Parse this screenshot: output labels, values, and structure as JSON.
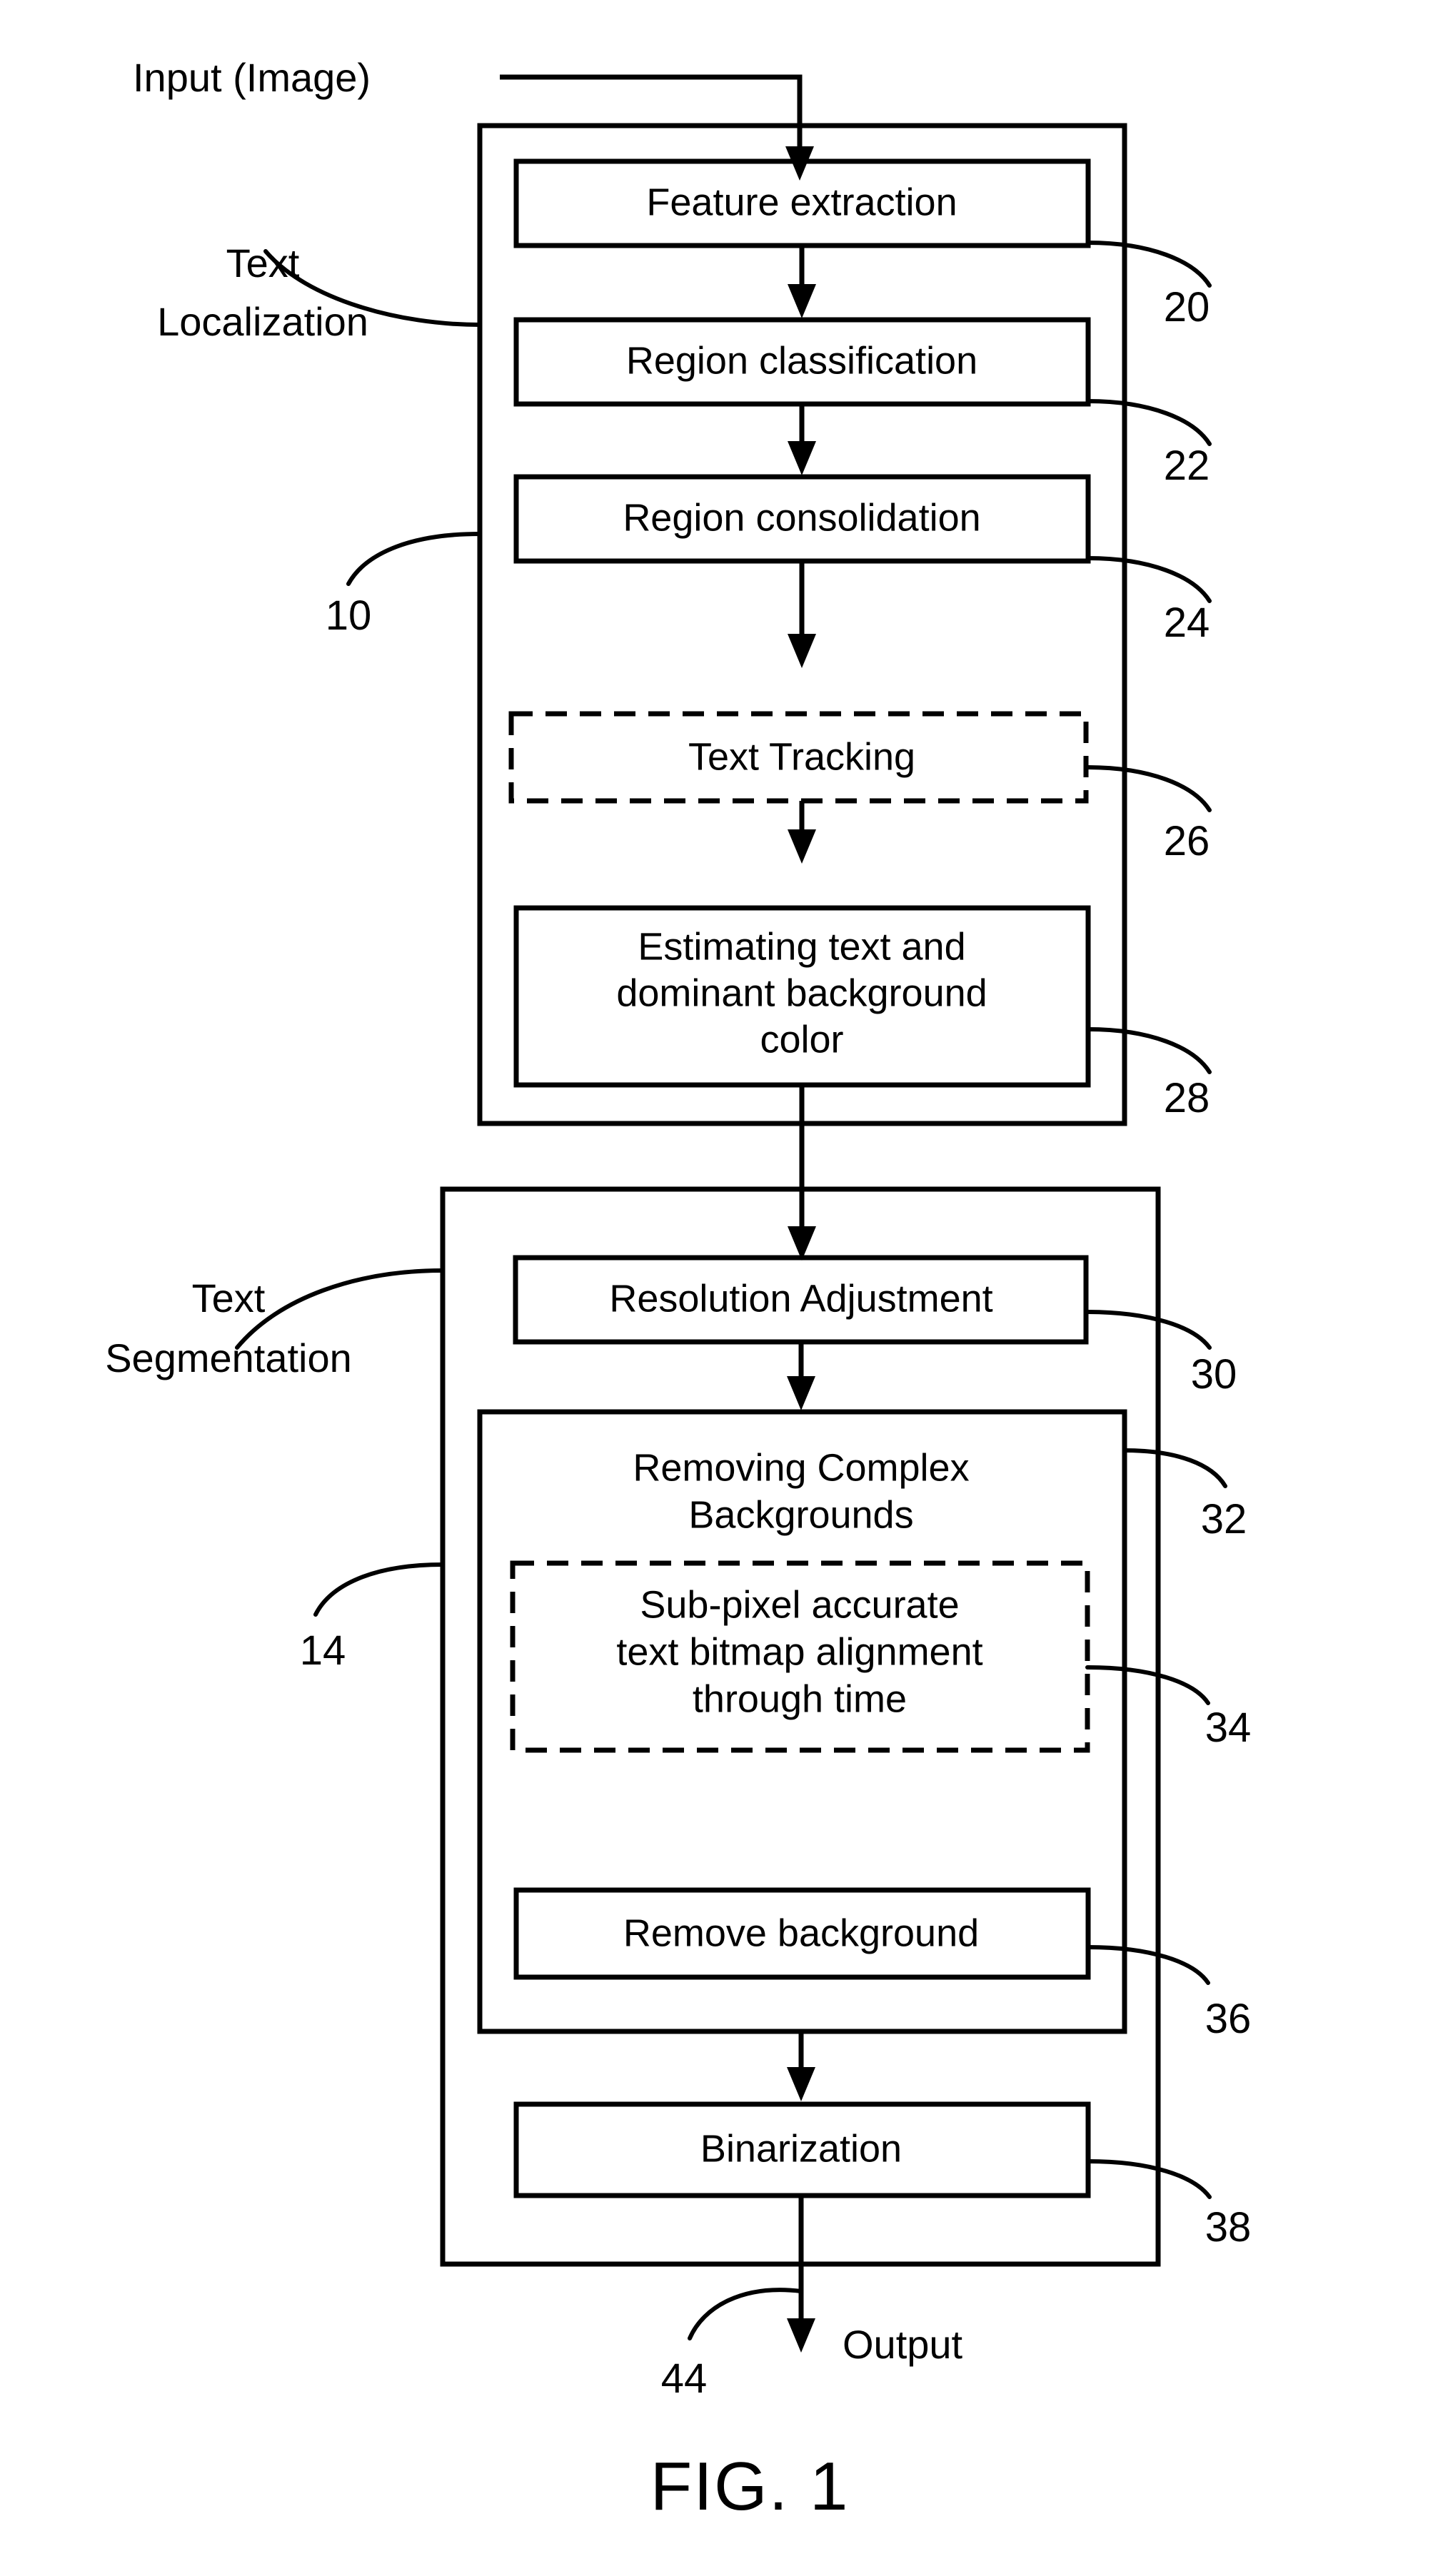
{
  "figure": {
    "caption": "FIG. 1",
    "input_label": "Input (Image)",
    "output_label": "Output",
    "output_ref": "44"
  },
  "stages": [
    {
      "key": "text_localization",
      "side_label_line1": "Text",
      "side_label_line2": "Localization",
      "ref": "10",
      "steps": [
        {
          "key": "feature_extraction",
          "label": "Feature extraction",
          "ref": "20",
          "style": "solid"
        },
        {
          "key": "region_classification",
          "label": "Region classification",
          "ref": "22",
          "style": "solid"
        },
        {
          "key": "region_consolidation",
          "label": "Region consolidation",
          "ref": "24",
          "style": "solid"
        },
        {
          "key": "text_tracking",
          "label": "Text Tracking",
          "ref": "26",
          "style": "dashed"
        },
        {
          "key": "estimating_color",
          "label_line1": "Estimating text and",
          "label_line2": "dominant background",
          "label_line3": "color",
          "ref": "28",
          "style": "solid"
        }
      ]
    },
    {
      "key": "text_segmentation",
      "side_label_line1": "Text",
      "side_label_line2": "Segmentation",
      "ref": "14",
      "steps": [
        {
          "key": "resolution_adjustment",
          "label": "Resolution Adjustment",
          "ref": "30",
          "style": "solid"
        },
        {
          "key": "removing_complex_backgrounds",
          "label_line1": "Removing Complex",
          "label_line2": "Backgrounds",
          "ref": "32",
          "style": "solid",
          "children": [
            {
              "key": "subpixel_alignment",
              "label_line1": "Sub-pixel accurate",
              "label_line2": "text bitmap alignment",
              "label_line3": "through time",
              "ref": "34",
              "style": "dashed"
            },
            {
              "key": "remove_background",
              "label": "Remove background",
              "ref": "36",
              "style": "solid"
            }
          ]
        },
        {
          "key": "binarization",
          "label": "Binarization",
          "ref": "38",
          "style": "solid"
        }
      ]
    }
  ],
  "colors": {
    "stroke": "#000000",
    "background": "#ffffff",
    "text": "#000000"
  }
}
